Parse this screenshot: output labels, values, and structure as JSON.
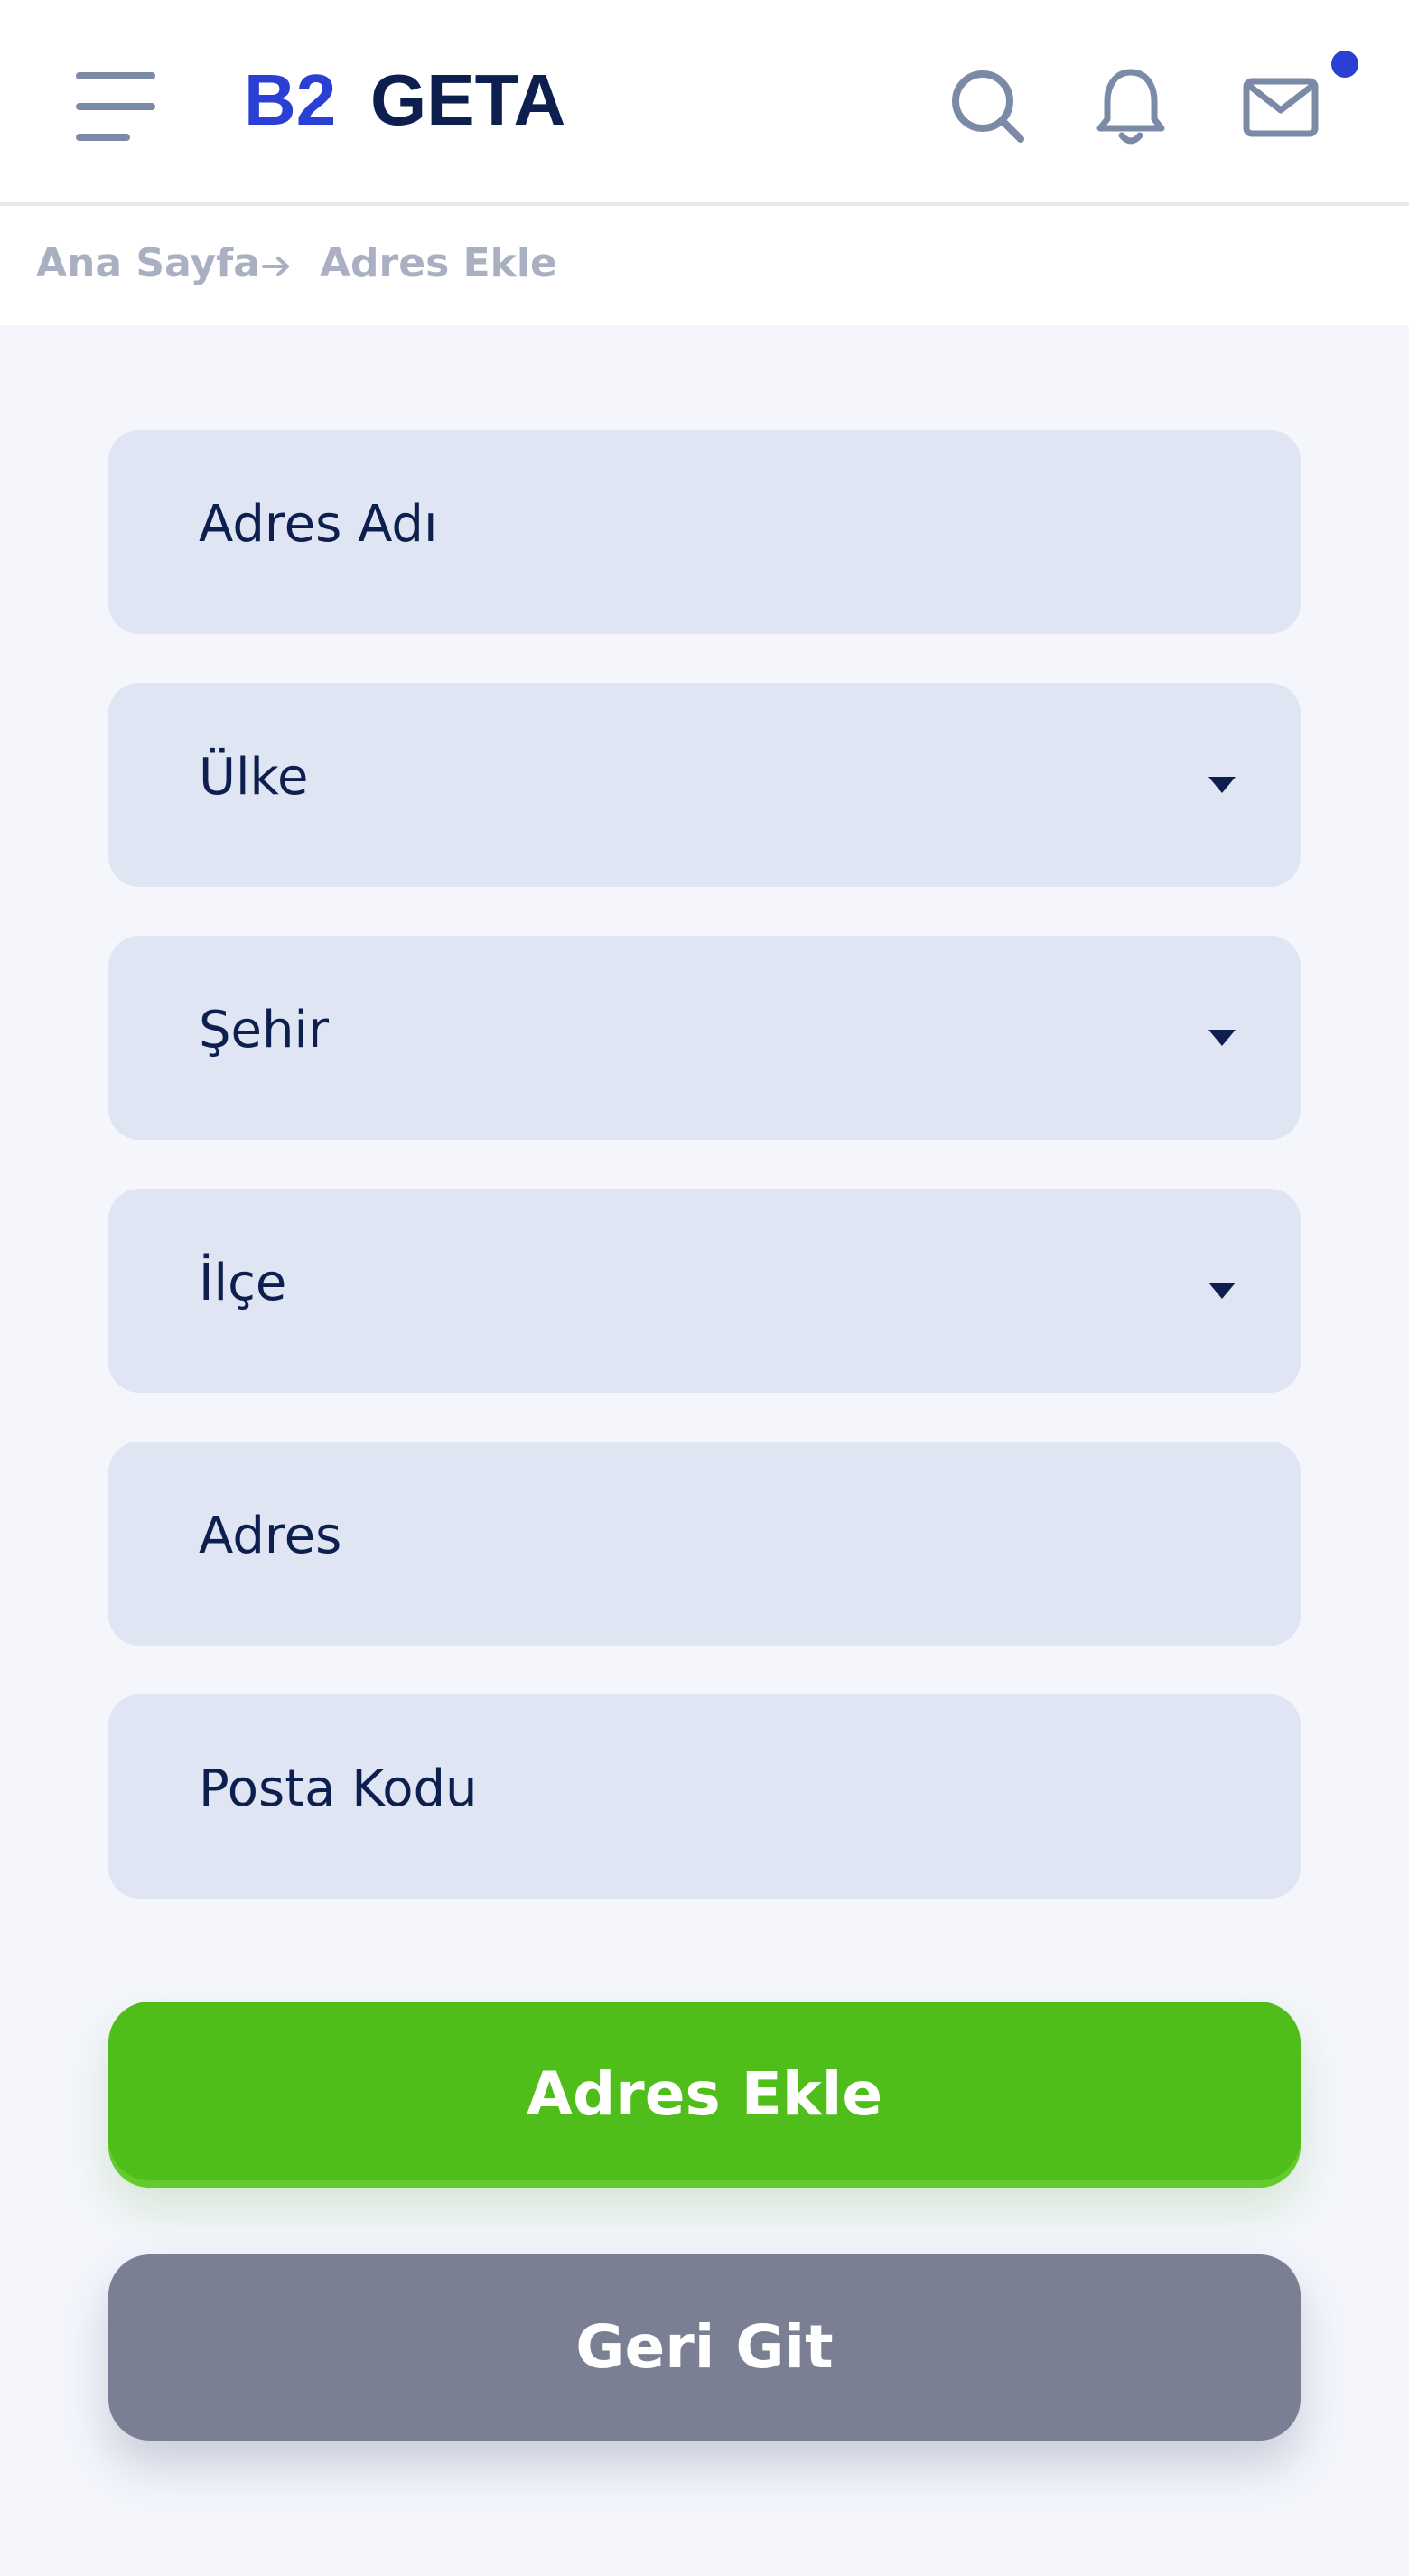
{
  "header": {
    "brand_primary": "B2",
    "brand_secondary": "GETA",
    "brand_colors": {
      "primary": "#2a3fd4",
      "secondary": "#0d1f4e"
    },
    "icons": [
      "menu-icon",
      "search-icon",
      "bell-icon",
      "mail-icon"
    ],
    "notification_dot_color": "#2a3fd4"
  },
  "breadcrumb": {
    "home": "Ana Sayfa",
    "current": "Adres Ekle"
  },
  "form": {
    "fields": [
      {
        "label": "Adres Adı",
        "type": "text"
      },
      {
        "label": "Ülke",
        "type": "select"
      },
      {
        "label": "Şehir",
        "type": "select"
      },
      {
        "label": "İlçe",
        "type": "select"
      },
      {
        "label": "Adres",
        "type": "text"
      },
      {
        "label": "Posta Kodu",
        "type": "text"
      }
    ],
    "submit_label": "Adres Ekle",
    "back_label": "Geri Git",
    "colors": {
      "submit": "#4fbd1a",
      "back": "#7a7f94",
      "field": "#e0e5f4"
    }
  }
}
